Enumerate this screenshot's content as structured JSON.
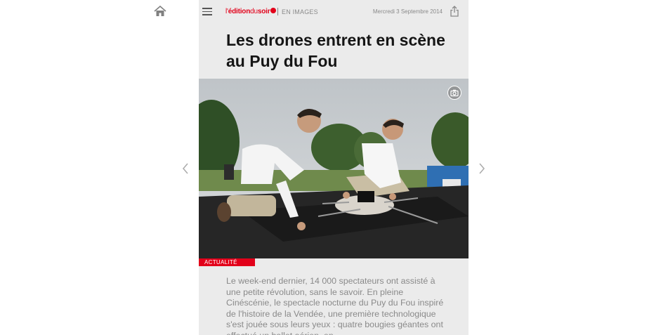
{
  "header": {
    "logo": {
      "l": "l'",
      "edition": "édition",
      "du": "du",
      "soir": "soir"
    },
    "section_label": "EN IMAGES",
    "date": "Mercredi 3 Septembre 2014"
  },
  "article": {
    "headline": "Les drones entrent en scène au Puy du Fou",
    "category": "ACTUALITÉ",
    "body": "Le week-end dernier, 14 000 spectateurs ont assisté à une petite révolution, sans le savoir. En pleine Cinéscénie, le spectacle nocturne du Puy du Fou inspiré de l'histoire de la Vendée, une première technologique s'est jouée sous leurs yeux : quatre bougies géantes ont effectué un ballet aérien, en"
  },
  "icons": {
    "home": "home-icon",
    "menu": "hamburger-menu-icon",
    "share": "share-icon",
    "camera": "camera-icon",
    "prev": "chevron-left-icon",
    "next": "chevron-right-icon"
  },
  "colors": {
    "accent": "#e2001a",
    "article_bg": "#ebebeb",
    "body_text": "#8a8a8a"
  }
}
